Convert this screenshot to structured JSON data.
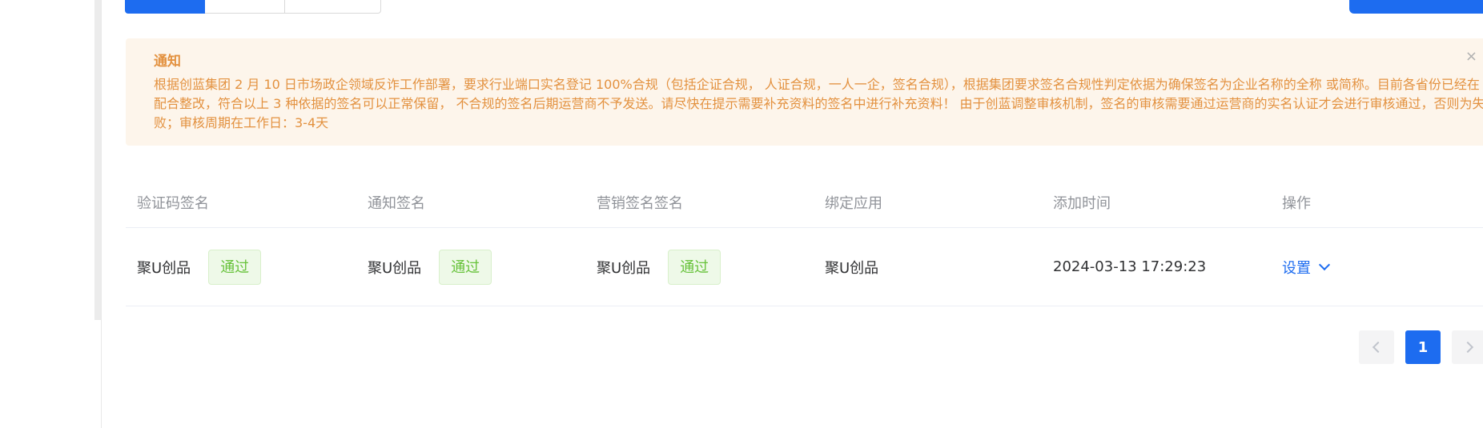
{
  "notice": {
    "title": "通知",
    "body": "根据创蓝集团 2 月 10 日市场政企领域反诈工作部署，要求行业端口实名登记 100%合规（包括企证合规， 人证合规，一人一企，签名合规），根据集团要求签名合规性判定依据为确保签名为企业名称的全称 或简称。目前各省份已经在配合整改，符合以上 3 种依据的签名可以正常保留， 不合规的签名后期运营商不予发送。请尽快在提示需要补充资料的签名中进行补充资料！ 由于创蓝调整审核机制，签名的审核需要通过运营商的实名认证才会进行审核通过，否则为失败；审核周期在工作日：3-4天",
    "close_symbol": "×"
  },
  "table": {
    "headers": [
      "验证码签名",
      "通知签名",
      "营销签名签名",
      "绑定应用",
      "添加时间",
      "操作"
    ],
    "rows": [
      {
        "verify_sign": "聚U创品",
        "verify_status": "通过",
        "notify_sign": "聚U创品",
        "notify_status": "通过",
        "marketing_sign": "聚U创品",
        "marketing_status": "通过",
        "bound_app": "聚U创品",
        "added_time": "2024-03-13 17:29:23",
        "action": "设置"
      }
    ]
  },
  "pagination": {
    "current_page": "1"
  },
  "colors": {
    "primary": "#1d6cf0",
    "notice_bg": "#fdf5eb",
    "notice_text": "#e3913f",
    "success": "#67c23a"
  },
  "icons": {
    "close": "close-icon",
    "action_dropdown": "chevron-down-icon",
    "prev_page": "chevron-left-icon",
    "next_page": "chevron-right-icon"
  }
}
